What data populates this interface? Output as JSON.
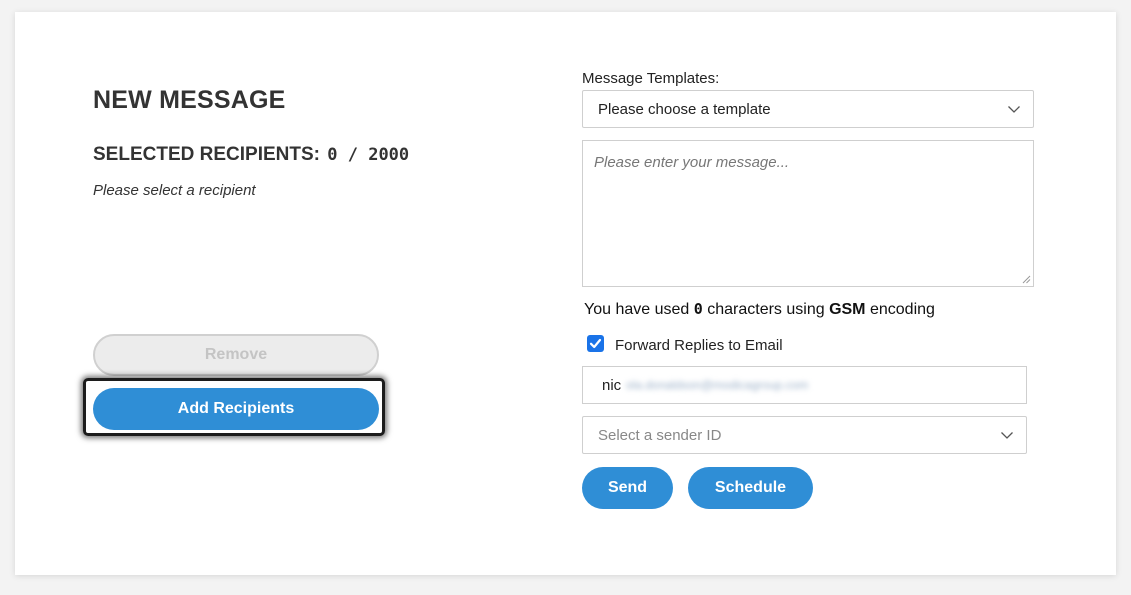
{
  "left": {
    "title": "NEW MESSAGE",
    "recipients_label": "SELECTED RECIPIENTS:",
    "recipients_count": "0 / 2000",
    "recipients_note": "Please select a recipient",
    "remove_label": "Remove",
    "add_label": "Add Recipients"
  },
  "right": {
    "templates_label": "Message Templates:",
    "templates_selected": "Please choose a template",
    "message_placeholder": "Please enter your message...",
    "char_prefix": "You have used",
    "char_count": "0",
    "char_middle": "characters using",
    "encoding": "GSM",
    "char_suffix": "encoding",
    "forward_checked": true,
    "forward_label": "Forward Replies to Email",
    "email_visible": "nic",
    "email_redacted": "ola.donaldson@modicagroup.com",
    "sender_placeholder": "Select a sender ID",
    "send_label": "Send",
    "schedule_label": "Schedule"
  },
  "colors": {
    "primary_button": "#2f8ed6",
    "checkbox": "#1a73e8",
    "disabled_button": "#ececec"
  },
  "icons": {
    "dropdown": "chevron-down-icon",
    "checkbox": "checkmark-icon",
    "textarea_resize": "resize-grip-icon"
  }
}
